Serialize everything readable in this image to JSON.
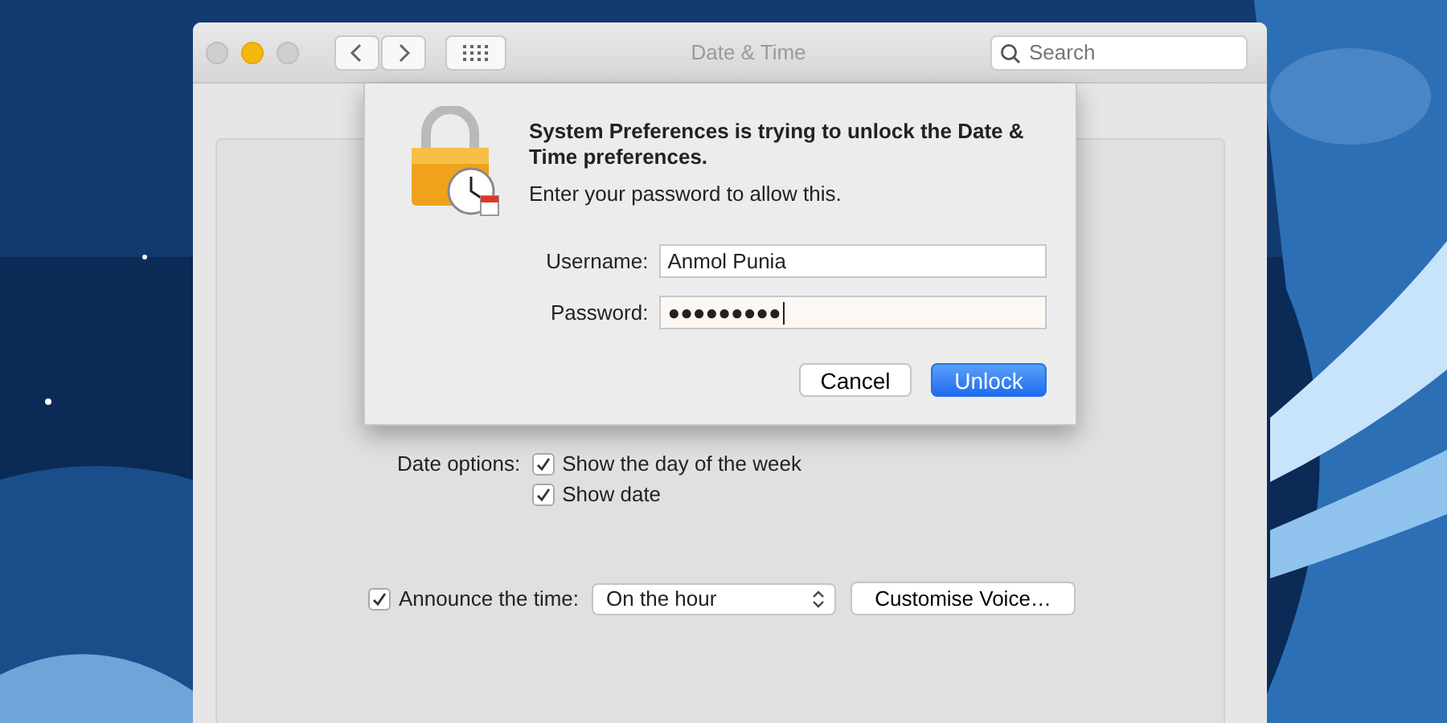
{
  "window": {
    "title": "Date & Time",
    "controls": [
      {
        "color": "#cfcfcf"
      },
      {
        "color": "#f6b80f"
      },
      {
        "color": "#cfcfcf"
      }
    ],
    "search": {
      "placeholder": "Search"
    }
  },
  "date_options": {
    "label": "Date options:",
    "checkboxes": [
      {
        "label": "Show the day of the week",
        "checked": true
      },
      {
        "label": "Show date",
        "checked": true
      }
    ]
  },
  "announce": {
    "checked": true,
    "label": "Announce the time:",
    "popup": "On the hour",
    "button": "Customise Voice…"
  },
  "dialog": {
    "heading": "System Preferences is trying to unlock the Date & Time preferences.",
    "message": "Enter your password to allow this.",
    "fields": [
      {
        "label": "Username:",
        "value": "Anmol Punia",
        "focused": false
      },
      {
        "label": "Password:",
        "value": "●●●●●●●●●",
        "focused": true
      }
    ],
    "buttons": [
      {
        "label": "Cancel",
        "kind": "normal"
      },
      {
        "label": "Unlock",
        "kind": "default"
      }
    ]
  }
}
